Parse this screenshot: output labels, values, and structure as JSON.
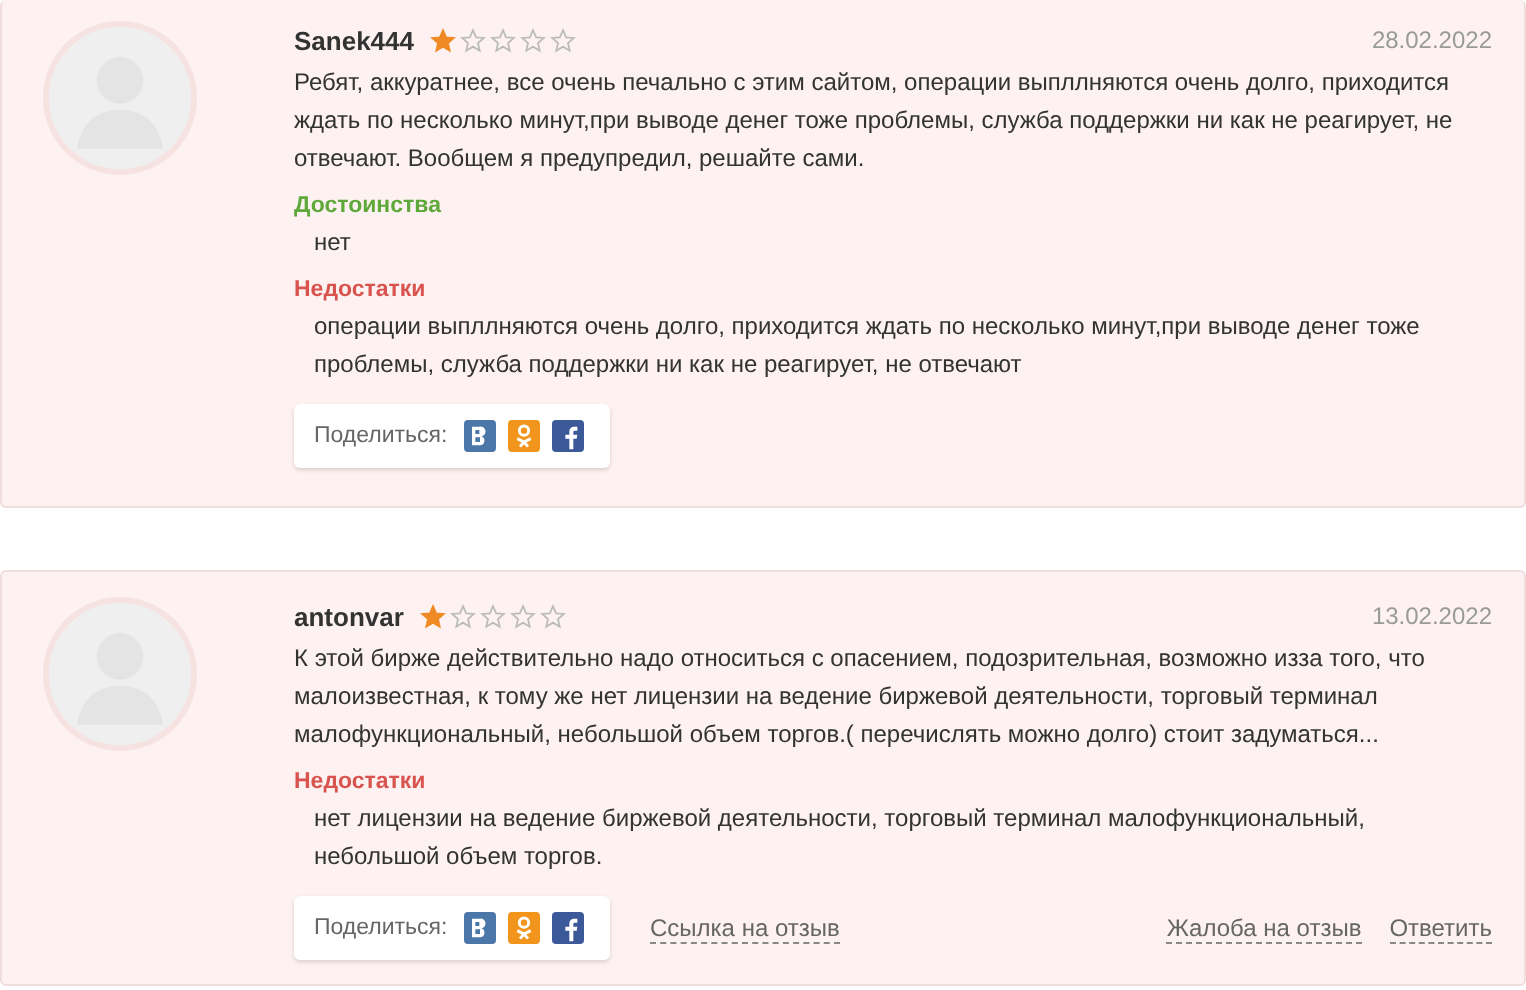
{
  "reviews": [
    {
      "author": "Sanek444",
      "stars": 1,
      "date": "28.02.2022",
      "text": "Ребят, аккуратнее, все очень печально с этим сайтом, операции выпллняются очень долго, приходится ждать по несколько минут,при выводе денег тоже проблемы, служба поддержки ни как не реагирует, не отвечают. Вообщем я предупредил, решайте сами.",
      "sections": [
        {
          "kind": "pros",
          "title": "Достоинства",
          "text": "нет"
        },
        {
          "kind": "cons",
          "title": "Недостатки",
          "text": "операции выпллняются очень долго, приходится ждать по несколько минут,при выводе денег тоже проблемы, служба поддержки ни как не реагирует, не отвечают"
        }
      ],
      "share_label": "Поделиться:"
    },
    {
      "author": "antonvar",
      "stars": 1,
      "date": "13.02.2022",
      "text": "К этой бирже действительно надо относиться с опасением, подозрительная, возможно изза того, что малоизвестная, к тому же нет лицензии на ведение биржевой деятельности, торговый терминал малофункциональный, небольшой объем торгов.( перечислять можно долго) стоит задуматься...",
      "sections": [
        {
          "kind": "cons",
          "title": "Недостатки",
          "text": "нет лицензии на ведение биржевой деятельности, торговый терминал малофункциональный, небольшой объем торгов."
        }
      ],
      "share_label": "Поделиться:",
      "link": "Ссылка на отзыв",
      "actions": [
        "Жалоба на отзыв",
        "Ответить"
      ]
    }
  ]
}
